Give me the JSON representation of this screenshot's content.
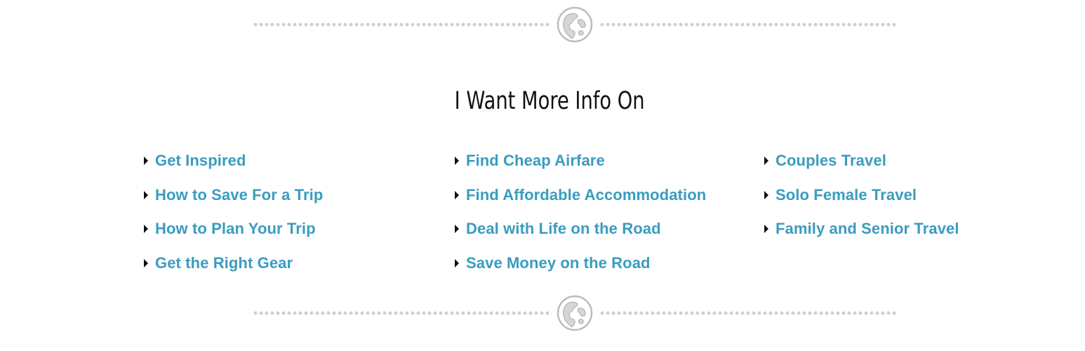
{
  "section": {
    "title": "I Want More Info On"
  },
  "icons": {
    "divider_icon": "globe-icon",
    "bullet_icon": "triangle-right-icon"
  },
  "colors": {
    "link": "#3a9cc0",
    "title": "#111111",
    "divider": "#cfcfcf"
  },
  "links": {
    "column1": [
      {
        "label": "Get Inspired"
      },
      {
        "label": "How to Save For a Trip"
      },
      {
        "label": "How to Plan Your Trip"
      },
      {
        "label": "Get the Right Gear"
      }
    ],
    "column2": [
      {
        "label": "Find Cheap Airfare"
      },
      {
        "label": "Find Affordable Accommodation"
      },
      {
        "label": "Deal with Life on the Road"
      },
      {
        "label": "Save Money on the Road"
      }
    ],
    "column3": [
      {
        "label": "Couples Travel"
      },
      {
        "label": "Solo Female Travel"
      },
      {
        "label": "Family and Senior Travel"
      }
    ]
  }
}
